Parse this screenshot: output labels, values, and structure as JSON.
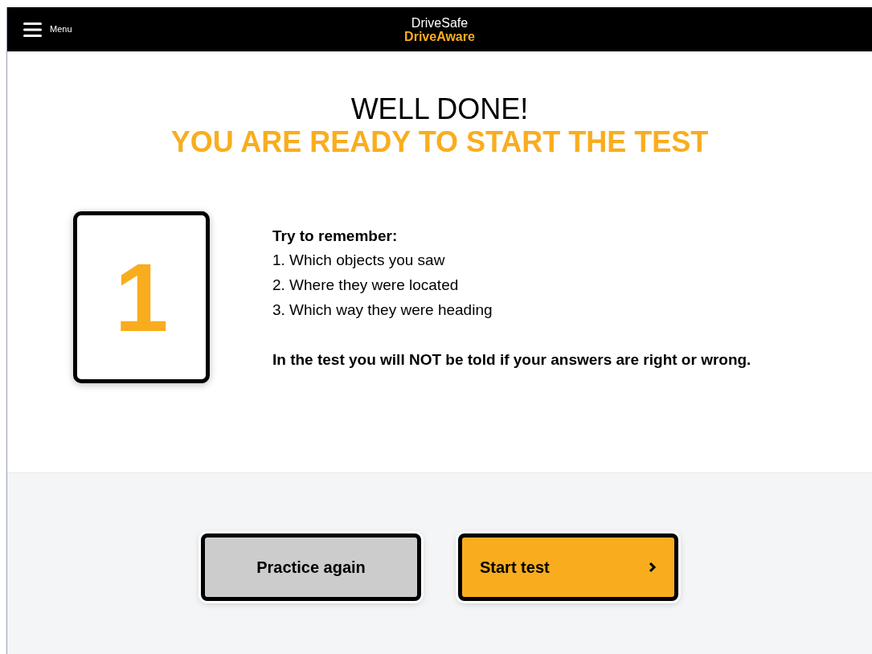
{
  "header": {
    "menu_label": "Menu",
    "brand_top": "DriveSafe",
    "brand_bottom": "DriveAware"
  },
  "heading": {
    "line1": "WELL DONE!",
    "line2": "YOU ARE READY TO START THE TEST"
  },
  "counter": "1",
  "instructions": {
    "title": "Try to remember:",
    "items": [
      "1. Which objects you saw",
      "2. Where they were located",
      "3. Which way they were heading"
    ],
    "note": "In the test you will NOT be told if your answers are right or wrong."
  },
  "buttons": [
    {
      "label": "Practice again",
      "kind": "secondary"
    },
    {
      "label": "Start test",
      "kind": "primary"
    }
  ]
}
